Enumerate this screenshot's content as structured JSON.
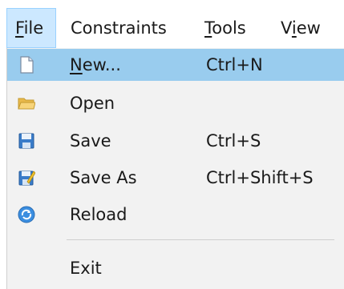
{
  "menubar": {
    "items": [
      {
        "label": "File",
        "mnemonic": "F",
        "rest": "ile",
        "open": true
      },
      {
        "label": "Constraints"
      },
      {
        "label": "Tools",
        "mnemonic": "T",
        "rest": "ools"
      },
      {
        "label": "View",
        "pre": "V",
        "mnemonic": "i",
        "rest": "ew"
      }
    ]
  },
  "file_menu": {
    "items": [
      {
        "mnemonic": "N",
        "rest": "ew...",
        "shortcut": "Ctrl+N",
        "icon": "new-document-icon",
        "highlighted": true
      },
      {
        "label": "Open",
        "shortcut": "",
        "icon": "open-folder-icon"
      },
      {
        "label": "Save",
        "shortcut": "Ctrl+S",
        "icon": "save-icon"
      },
      {
        "label": "Save As",
        "shortcut": "Ctrl+Shift+S",
        "icon": "save-as-icon"
      },
      {
        "label": "Reload",
        "shortcut": "",
        "icon": "reload-icon"
      },
      {
        "label": "Exit",
        "shortcut": ""
      }
    ]
  },
  "colors": {
    "highlight": "#99ccee",
    "menu_background": "#f2f2f2",
    "open_menu_header": "#cce8ff"
  }
}
